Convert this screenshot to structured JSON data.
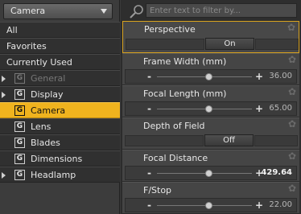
{
  "category_dropdown": {
    "selected": "Camera"
  },
  "list": {
    "all": "All",
    "favorites": "Favorites",
    "currently_used": "Currently Used",
    "tree": [
      {
        "label": "General",
        "expandable": true,
        "disabled": true
      },
      {
        "label": "Display",
        "expandable": true,
        "disabled": false
      },
      {
        "label": "Camera",
        "expandable": false,
        "selected": true
      },
      {
        "label": "Lens",
        "expandable": false
      },
      {
        "label": "Blades",
        "expandable": false
      },
      {
        "label": "Dimensions",
        "expandable": false
      },
      {
        "label": "Headlamp",
        "expandable": true
      }
    ],
    "group_icon": "G"
  },
  "search": {
    "placeholder": "Enter text to filter by..."
  },
  "properties": {
    "perspective": {
      "label": "Perspective",
      "value": "On"
    },
    "frame_width": {
      "label": "Frame Width (mm)",
      "value": "36.00",
      "level": 0.55
    },
    "focal_length": {
      "label": "Focal Length (mm)",
      "value": "65.00",
      "level": 0.55
    },
    "depth_of_field": {
      "label": "Depth of Field",
      "value": "Off"
    },
    "focal_distance": {
      "label": "Focal Distance",
      "value": "429.64",
      "level": 0.55
    },
    "fstop": {
      "label": "F/Stop",
      "value": "22.00",
      "level": 0.55
    }
  },
  "slider_minus": "-",
  "slider_plus": "+",
  "colors": {
    "selected_bg": "#f0b31e",
    "highlight_border": "#d8a21e"
  },
  "icons": {
    "search": "search-icon",
    "gear": "gear-icon",
    "expander": "expand-arrow-icon",
    "dropdown": "chevron-down-icon"
  }
}
